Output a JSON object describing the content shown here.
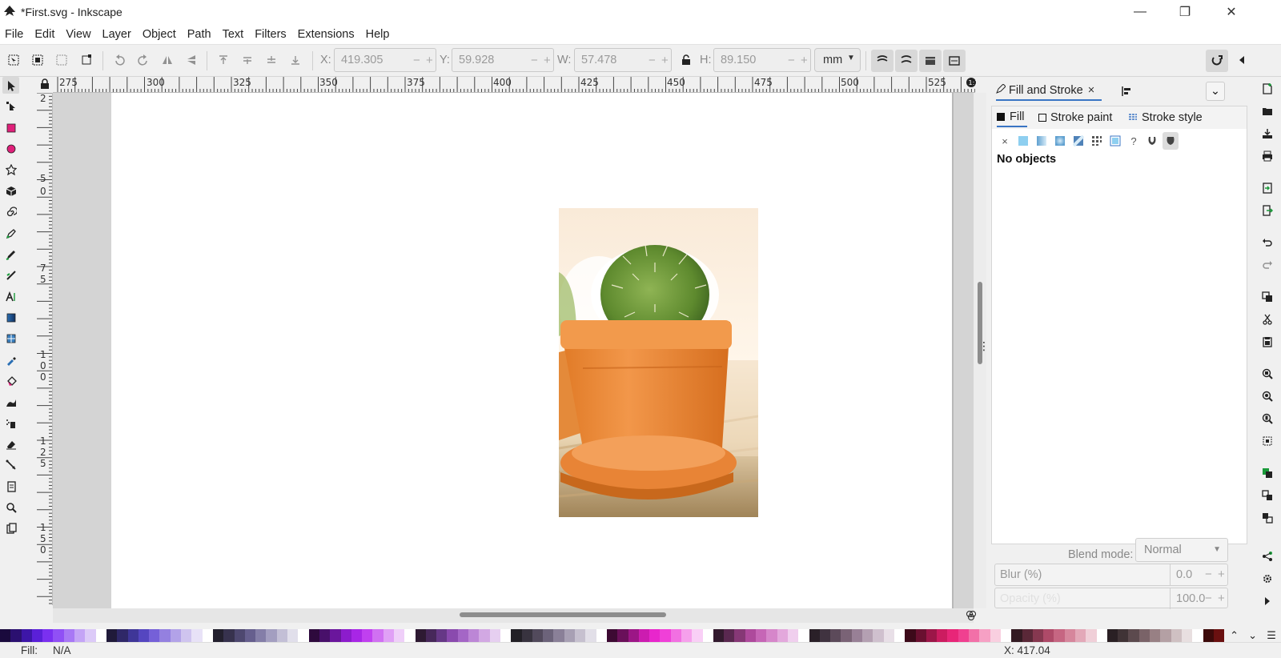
{
  "window": {
    "title": "*First.svg - Inkscape",
    "minimize_glyph": "—",
    "maximize_glyph": "❐",
    "close_glyph": "✕"
  },
  "menu": [
    "File",
    "Edit",
    "View",
    "Layer",
    "Object",
    "Path",
    "Text",
    "Filters",
    "Extensions",
    "Help"
  ],
  "controls": {
    "x_label": "X:",
    "x_value": "419.305",
    "y_label": "Y:",
    "y_value": "59.928",
    "w_label": "W:",
    "w_value": "57.478",
    "h_label": "H:",
    "h_value": "89.150",
    "unit": "mm",
    "spin_minus": "−",
    "spin_plus": "+"
  },
  "rulers": {
    "top_ticks": [
      "275",
      "300",
      "325",
      "350",
      "375",
      "400",
      "425",
      "450",
      "475",
      "500",
      "525"
    ],
    "left_ticks": [
      "2",
      "5",
      "0",
      "7",
      "5",
      "1",
      "0",
      "0",
      "1",
      "2",
      "5",
      "1",
      "5",
      "0"
    ]
  },
  "dock": {
    "tab_fill_stroke": "Fill and Stroke",
    "tab_close": "×",
    "collapse_glyph": "⌄",
    "fill_tabs": {
      "fill": "Fill",
      "stroke_paint": "Stroke paint",
      "stroke_style": "Stroke style"
    },
    "paint_none": "×",
    "paint_unknown": "?",
    "no_objects": "No objects",
    "blend_label": "Blend mode:",
    "blend_value": "Normal",
    "blur_label": "Blur (%)",
    "blur_value": "0.0",
    "opacity_label": "Opacity (%)",
    "opacity_value": "100.0",
    "spin_minus": "−",
    "spin_plus": "+"
  },
  "palette": {
    "colors": [
      "#1a0a3d",
      "#2b1070",
      "#3d16a8",
      "#5a20d8",
      "#7a30f0",
      "#9050f5",
      "#a878f5",
      "#c4a4f6",
      "#dccaf8",
      "#ffffff",
      "#201a3a",
      "#2f2868",
      "#3f3698",
      "#5546c0",
      "#7560d8",
      "#9480e0",
      "#b2a2e8",
      "#cfc4ef",
      "#e8e2f7",
      "#ffffff",
      "#23202e",
      "#37324e",
      "#4e4870",
      "#665f8e",
      "#847ea8",
      "#a39ec0",
      "#c3bfd6",
      "#e1dfeb",
      "#ffffff",
      "#2e0a3d",
      "#48106a",
      "#6a169c",
      "#8c1ccc",
      "#a826e6",
      "#c040f0",
      "#d070f2",
      "#e0a0f6",
      "#efcff9",
      "#ffffff",
      "#2e1a33",
      "#47285a",
      "#663886",
      "#8a4aae",
      "#a466c6",
      "#bc86d6",
      "#d2a8e3",
      "#e6cff0",
      "#ffffff",
      "#222026",
      "#38333f",
      "#524a5c",
      "#6c637a",
      "#8a8098",
      "#a8a0b4",
      "#c6c0cf",
      "#e2dfe8",
      "#ffffff",
      "#3d0a33",
      "#6a105a",
      "#9c1686",
      "#cc1cb0",
      "#e826cc",
      "#f040d8",
      "#f270e2",
      "#f6a0ec",
      "#f9cff6",
      "#ffffff",
      "#331a2e",
      "#5a2850",
      "#863876",
      "#ae4a9c",
      "#c666b6",
      "#d686ca",
      "#e3a8dc",
      "#f0cfee",
      "#ffffff",
      "#2a2028",
      "#403340",
      "#5c4a5a",
      "#7a6376",
      "#988096",
      "#b4a0b2",
      "#cfc0ce",
      "#e8dfe7",
      "#ffffff",
      "#3d0a1a",
      "#6a1030",
      "#9c1648",
      "#cc1c60",
      "#e82678",
      "#f04090",
      "#f270a8",
      "#f6a0c4",
      "#f9cfe0",
      "#ffffff",
      "#331a22",
      "#5a2838",
      "#863850",
      "#ae4a68",
      "#c66682",
      "#d6869c",
      "#e3a8b8",
      "#f0cfd8",
      "#ffffff",
      "#2a2024",
      "#403336",
      "#5c4a4e",
      "#7a6368",
      "#988084",
      "#b4a0a4",
      "#cfc0c2",
      "#e8dfe0",
      "#ffffff",
      "#3d0a0a",
      "#6a1010"
    ],
    "up": "⌃",
    "down": "⌄",
    "menu": "☰"
  },
  "status": {
    "fill_label": "Fill:",
    "fill_value": "N/A",
    "x_readout": "X:  417.04"
  }
}
